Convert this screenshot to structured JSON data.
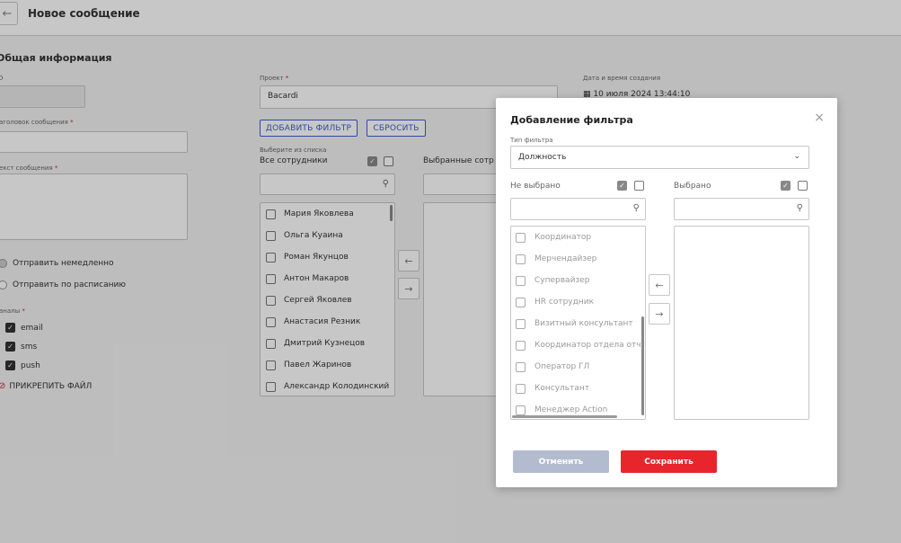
{
  "header": {
    "back_icon": "←",
    "title": "Новое сообщение"
  },
  "form": {
    "section_title": "Общая информация",
    "id_label": "D",
    "subject_label": "аголовок сообщения",
    "text_label": "екст сообщения",
    "required_mark": "*",
    "send_now": "Отправить немедленно",
    "send_schedule": "Отправить по расписанию",
    "channels_label": "аналы",
    "channels": [
      "email",
      "sms",
      "push"
    ],
    "attach_label": "ПРИКРЕПИТЬ ФАЙЛ",
    "project_label": "Проект",
    "project_value": "Bacardi",
    "add_filter": "ДОБАВИТЬ ФИЛЬТР",
    "reset": "СБРОСИТЬ",
    "choose_label": "Выберите из списка",
    "all_employees": "Все сотрудники",
    "selected_employees": "Выбранные сотр",
    "employees": [
      "Мария Яковлева",
      "Ольга Куаина",
      "Роман Якунцов",
      "Антон Макаров",
      "Сергей Яковлев",
      "Анастасия Резник",
      "Дмитрий Кузнецов",
      "Павел Жаринов",
      "Александр Колодинский"
    ],
    "date_label": "Дата и время создания",
    "date_value": "10 июля 2024 13:44:10"
  },
  "modal": {
    "title": "Добавление фильтра",
    "close_icon": "×",
    "filter_type_label": "Тип фильтра",
    "filter_type_value": "Должность",
    "not_selected": "Не выбрано",
    "selected": "Выбрано",
    "options": [
      "Координатор",
      "Мерчендайзер",
      "Супервайзер",
      "HR сотрудник",
      "Визитный консультант",
      "Координатор отдела отч",
      "Оператор ГЛ",
      "Консультант",
      "Менеджер Action"
    ],
    "cancel": "Отменить",
    "save": "Сохранить"
  },
  "colors": {
    "accent": "#3b5bd9",
    "save": "#e8252d",
    "cancel": "#b3bccf"
  }
}
